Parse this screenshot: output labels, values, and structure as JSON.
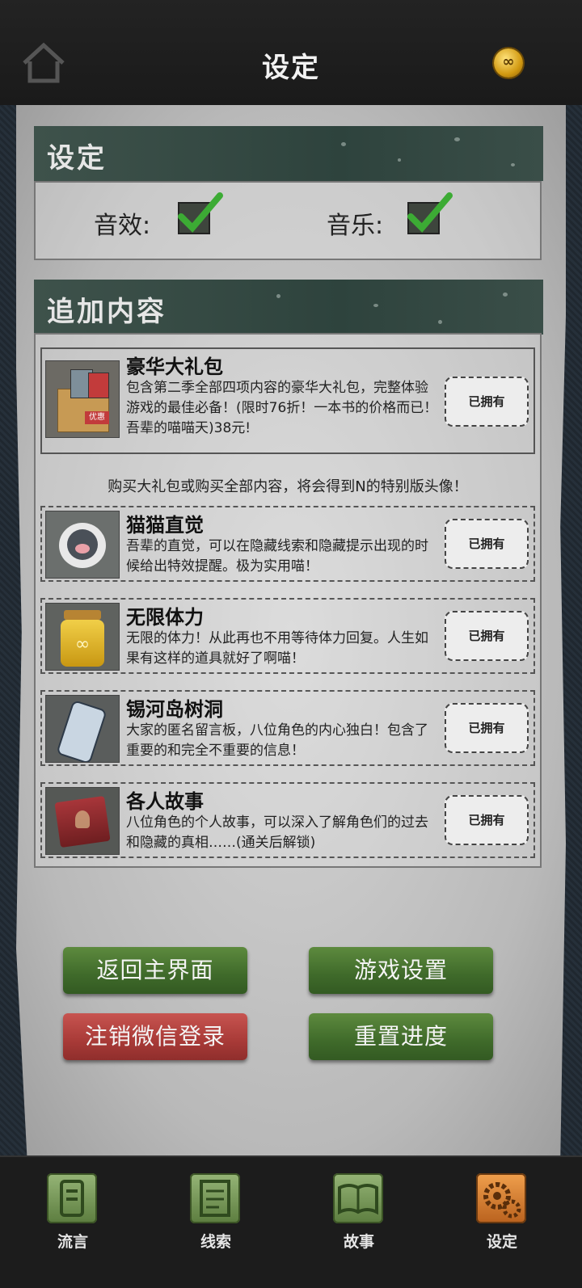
{
  "header": {
    "title": "设定"
  },
  "settings": {
    "heading": "设定",
    "sound_label": "音效:",
    "music_label": "音乐:",
    "sound_checked": true,
    "music_checked": true
  },
  "addons": {
    "heading": "追加内容",
    "bundle": {
      "title": "豪华大礼包",
      "desc": "包含第二季全部四项内容的豪华大礼包，完整体验游戏的最佳必备！(限时76折！一本书的价格而已！吾辈的喵喵天)38元!",
      "thumb_label": "优惠",
      "owned": "已拥有"
    },
    "notice": "购买大礼包或购买全部内容，将会得到N的特别版头像！",
    "items": [
      {
        "title": "猫猫直觉",
        "desc": "吾辈的直觉，可以在隐藏线索和隐藏提示出现的时候给出特效提醒。极为实用喵！",
        "owned": "已拥有"
      },
      {
        "title": "无限体力",
        "desc": "无限的体力！从此再也不用等待体力回复。人生如果有这样的道具就好了啊喵！",
        "owned": "已拥有"
      },
      {
        "title": "锡河岛树洞",
        "desc": "大家的匿名留言板，八位角色的内心独白！包含了重要的和完全不重要的信息！",
        "owned": "已拥有"
      },
      {
        "title": "各人故事",
        "desc": "八位角色的个人故事，可以深入了解角色们的过去和隐藏的真相……(通关后解锁)",
        "owned": "已拥有"
      }
    ]
  },
  "buttons": {
    "return_main": "返回主界面",
    "game_settings": "游戏设置",
    "logout_wechat": "注销微信登录",
    "reset_progress": "重置进度"
  },
  "tabs": [
    {
      "label": "流言"
    },
    {
      "label": "线索"
    },
    {
      "label": "故事"
    },
    {
      "label": "设定"
    }
  ],
  "colors": {
    "green_button": "#4a7a33",
    "red_button": "#b03f3c",
    "section_header": "#34483f",
    "active_tab": "#d9802f"
  }
}
